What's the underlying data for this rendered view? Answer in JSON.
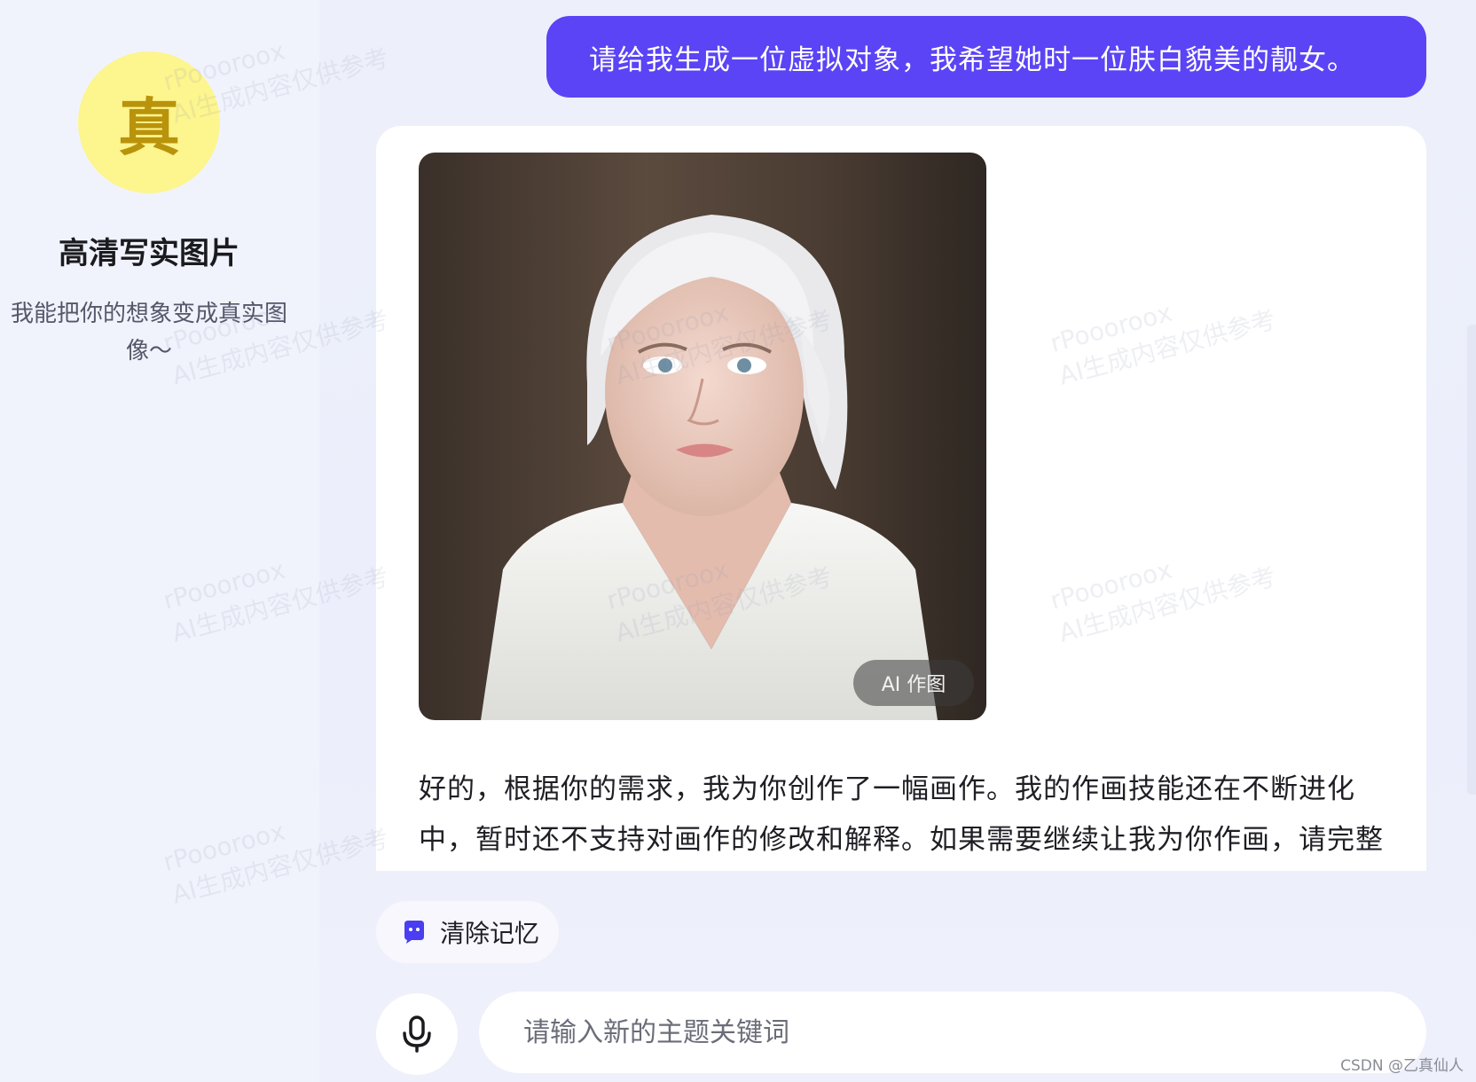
{
  "sidebar": {
    "avatar_char": "真",
    "bot_name": "高清写实图片",
    "bot_desc": "我能把你的想象变成真实图像～"
  },
  "chat": {
    "user_message": "请给我生成一位虚拟对象，我希望她时一位肤白貌美的靓女。",
    "image_badge": "AI 作图",
    "bot_reply": "好的，根据你的需求，我为你创作了一幅画作。我的作画技能还在不断进化中，暂时还不支持对画作的修改和解释。如果需要继续让我为你作画，请完整"
  },
  "actions": {
    "clear_memory_label": "清除记忆",
    "mic_icon": "microphone-icon",
    "clear_icon": "ghost-chat-icon"
  },
  "input": {
    "placeholder": "请输入新的主题关键词"
  },
  "watermark": {
    "line1": "rPooorooх",
    "line2": "AI生成内容仅供参考"
  },
  "footer": {
    "credit": "CSDN @乙真仙人"
  },
  "colors": {
    "accent": "#5b44f5",
    "avatar_bg": "#fdf58e",
    "avatar_fg": "#b9930c"
  }
}
